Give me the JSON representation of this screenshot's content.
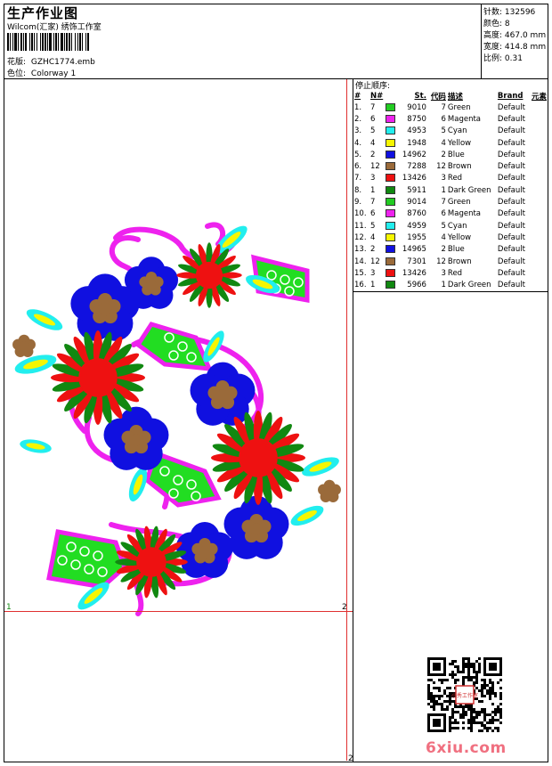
{
  "header": {
    "title": "生产作业图",
    "company": "Wilcom(汇家) 绣饰工作室",
    "design_label": "花版:",
    "design_value": "GZHC1774.emb",
    "colorway_label": "色位:",
    "colorway_value": "Colorway 1"
  },
  "stats": [
    {
      "label": "针数:",
      "value": "132596"
    },
    {
      "label": "颜色:",
      "value": "8"
    },
    {
      "label": "高度:",
      "value": "467.0 mm"
    },
    {
      "label": "宽度:",
      "value": "414.8 mm"
    },
    {
      "label": "比例:",
      "value": "0.31"
    }
  ],
  "stop_sequence": {
    "title": "停止顺序:",
    "headers": [
      "#",
      "N#",
      "St.",
      "代码",
      "描述",
      "Brand",
      "元素"
    ],
    "rows": [
      {
        "idx": "1.",
        "n": "7",
        "color": "#22cc22",
        "st": "9010",
        "code": "7",
        "desc": "Green",
        "brand": "Default"
      },
      {
        "idx": "2.",
        "n": "6",
        "color": "#ee22ee",
        "st": "8750",
        "code": "6",
        "desc": "Magenta",
        "brand": "Default"
      },
      {
        "idx": "3.",
        "n": "5",
        "color": "#22eeee",
        "st": "4953",
        "code": "5",
        "desc": "Cyan",
        "brand": "Default"
      },
      {
        "idx": "4.",
        "n": "4",
        "color": "#f6f600",
        "st": "1948",
        "code": "4",
        "desc": "Yellow",
        "brand": "Default"
      },
      {
        "idx": "5.",
        "n": "2",
        "color": "#1010e0",
        "st": "14962",
        "code": "2",
        "desc": "Blue",
        "brand": "Default"
      },
      {
        "idx": "6.",
        "n": "12",
        "color": "#9a6a3a",
        "st": "7288",
        "code": "12",
        "desc": "Brown",
        "brand": "Default"
      },
      {
        "idx": "7.",
        "n": "3",
        "color": "#ee1111",
        "st": "13426",
        "code": "3",
        "desc": "Red",
        "brand": "Default"
      },
      {
        "idx": "8.",
        "n": "1",
        "color": "#118811",
        "st": "5911",
        "code": "1",
        "desc": "Dark Green",
        "brand": "Default"
      },
      {
        "idx": "9.",
        "n": "7",
        "color": "#22cc22",
        "st": "9014",
        "code": "7",
        "desc": "Green",
        "brand": "Default"
      },
      {
        "idx": "10.",
        "n": "6",
        "color": "#ee22ee",
        "st": "8760",
        "code": "6",
        "desc": "Magenta",
        "brand": "Default"
      },
      {
        "idx": "11.",
        "n": "5",
        "color": "#22eeee",
        "st": "4959",
        "code": "5",
        "desc": "Cyan",
        "brand": "Default"
      },
      {
        "idx": "12.",
        "n": "4",
        "color": "#f6f600",
        "st": "1955",
        "code": "4",
        "desc": "Yellow",
        "brand": "Default"
      },
      {
        "idx": "13.",
        "n": "2",
        "color": "#1010e0",
        "st": "14965",
        "code": "2",
        "desc": "Blue",
        "brand": "Default"
      },
      {
        "idx": "14.",
        "n": "12",
        "color": "#9a6a3a",
        "st": "7301",
        "code": "12",
        "desc": "Brown",
        "brand": "Default"
      },
      {
        "idx": "15.",
        "n": "3",
        "color": "#ee1111",
        "st": "13426",
        "code": "3",
        "desc": "Red",
        "brand": "Default"
      },
      {
        "idx": "16.",
        "n": "1",
        "color": "#118811",
        "st": "5966",
        "code": "1",
        "desc": "Dark Green",
        "brand": "Default"
      }
    ]
  },
  "design": {
    "corner_labels": {
      "left": "1",
      "right": "2",
      "bottom": "2"
    }
  },
  "footer": {
    "qr_stamp": "小秀工作室",
    "logo": "6xiu.com"
  },
  "colors": {
    "red_guide": "#e03030",
    "magenta": "#ee22ee",
    "blue": "#1010e0",
    "brown": "#9a6a3a",
    "red": "#ee1111",
    "dark_green": "#118811",
    "green": "#22dd22",
    "cyan": "#22eeee",
    "yellow": "#f6f600",
    "logo_pink": "#f07080"
  }
}
